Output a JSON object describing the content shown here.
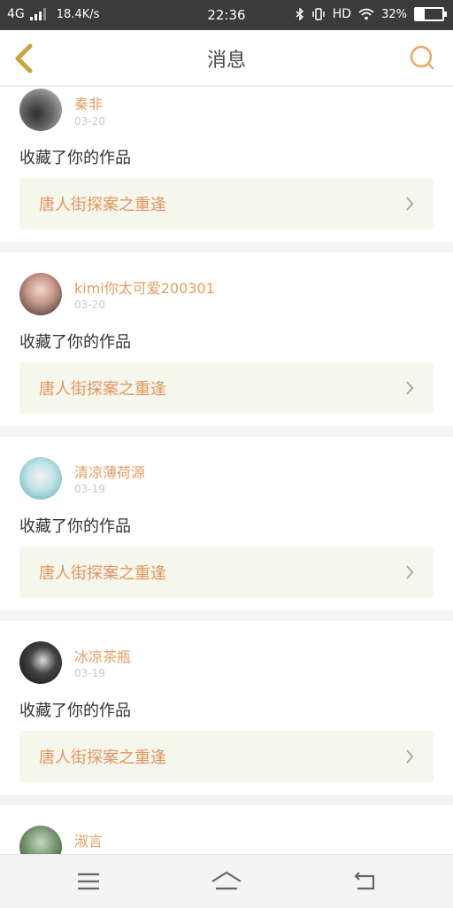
{
  "status_bar": {
    "network": "4G",
    "speed": "18.4K/s",
    "time": "22:36",
    "hd": "HD",
    "battery": "32%",
    "battery_level": 0.32
  },
  "header": {
    "title": "消息",
    "back_icon": "chevron-left-icon",
    "search_icon": "search-icon"
  },
  "messages": [
    {
      "name": "秦非",
      "date": "03-20",
      "action": "收藏了你的作品",
      "work": "唐人街探案之重逢"
    },
    {
      "name": "kimi你太可爱200301",
      "date": "03-20",
      "action": "收藏了你的作品",
      "work": "唐人街探案之重逢"
    },
    {
      "name": "清凉薄荷源",
      "date": "03-19",
      "action": "收藏了你的作品",
      "work": "唐人街探案之重逢"
    },
    {
      "name": "冰凉茶瓶",
      "date": "03-19",
      "action": "收藏了你的作品",
      "work": "唐人街探案之重逢"
    },
    {
      "name": "淑言"
    }
  ],
  "nav": {
    "menu_icon": "menu-icon",
    "home_icon": "home-icon",
    "back_icon": "return-icon"
  },
  "colors": {
    "accent": "#e59c63",
    "card_bg": "#f5f6ec",
    "statusbar_bg": "#3b3b3b"
  }
}
